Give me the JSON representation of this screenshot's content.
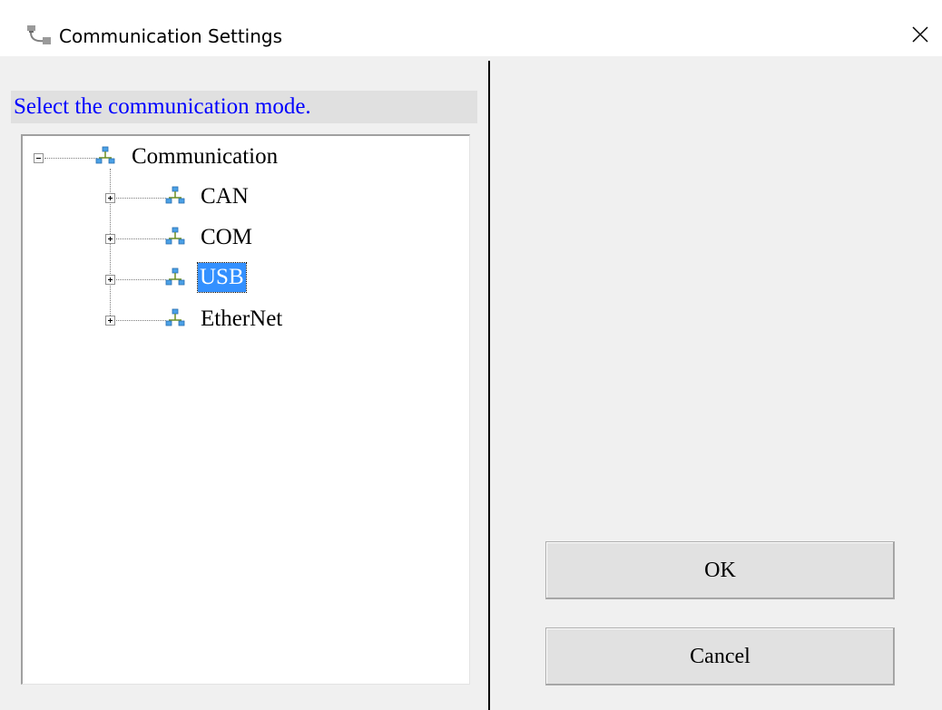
{
  "window": {
    "title": "Communication Settings",
    "icon": "serial-cable-icon",
    "close_icon": "close-icon"
  },
  "header": {
    "label": "Select the communication mode."
  },
  "tree": {
    "root": {
      "label": "Communication",
      "expanded": true,
      "icon": "network-icon"
    },
    "children": [
      {
        "label": "CAN",
        "expanded": false,
        "selected": false,
        "icon": "network-icon"
      },
      {
        "label": "COM",
        "expanded": false,
        "selected": false,
        "icon": "network-icon"
      },
      {
        "label": "USB",
        "expanded": false,
        "selected": true,
        "icon": "network-icon"
      },
      {
        "label": "EtherNet",
        "expanded": false,
        "selected": false,
        "icon": "network-icon"
      }
    ]
  },
  "buttons": {
    "ok_label": "OK",
    "cancel_label": "Cancel"
  },
  "colors": {
    "header_text": "#0000ff",
    "selection_bg": "#3390ff"
  }
}
